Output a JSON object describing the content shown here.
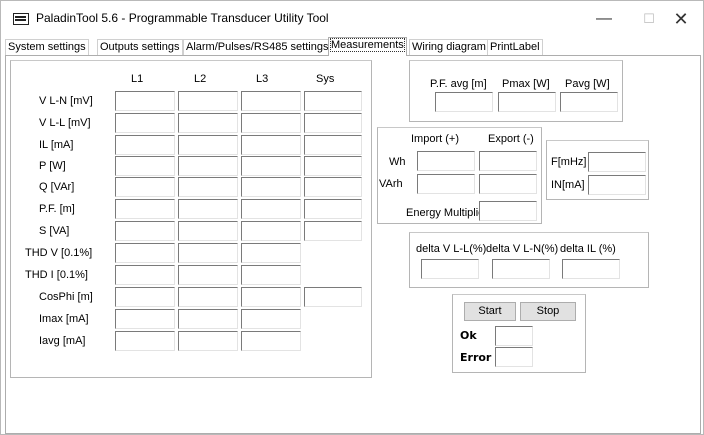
{
  "window": {
    "title": "PaladinTool 5.6 -  Programmable Transducer Utility Tool",
    "controls": {
      "minimize": "—",
      "maximize": "☐",
      "close": "✕"
    }
  },
  "tabs": [
    {
      "label": "System settings"
    },
    {
      "label": "Outputs settings"
    },
    {
      "label": "Alarm/Pulses/RS485 settings"
    },
    {
      "label": "Measurements"
    },
    {
      "label": "Wiring diagram"
    },
    {
      "label": "PrintLabel"
    }
  ],
  "measurements": {
    "columns": [
      "L1",
      "L2",
      "L3",
      "Sys"
    ],
    "rows": [
      {
        "label": "V L-N [mV]"
      },
      {
        "label": "V L-L [mV]"
      },
      {
        "label": "IL [mA]"
      },
      {
        "label": "P [W]"
      },
      {
        "label": "Q [VAr]"
      },
      {
        "label": "P.F. [m]"
      },
      {
        "label": "S [VA]"
      },
      {
        "label": "THD V [0.1%]"
      },
      {
        "label": "THD I [0.1%]"
      },
      {
        "label": "CosPhi [m]"
      },
      {
        "label": "Imax [mA]"
      },
      {
        "label": "Iavg [mA]"
      }
    ]
  },
  "power_summary": {
    "pf_avg": "P.F. avg [m]",
    "pmax": "Pmax [W]",
    "pavg": "Pavg [W]"
  },
  "energy": {
    "import": "Import (+)",
    "export": "Export (-)",
    "wh": "Wh",
    "varh": "VArh",
    "multiplier": "Energy Multiplier"
  },
  "frequency": {
    "f": "F[mHz]",
    "in": "IN[mA]"
  },
  "deltas": {
    "vll": "delta V L-L(%)",
    "vln": "delta V L-N(%)",
    "il": "delta IL (%)"
  },
  "control": {
    "start": "Start",
    "stop": "Stop",
    "ok": "Ok",
    "error": "Error"
  }
}
